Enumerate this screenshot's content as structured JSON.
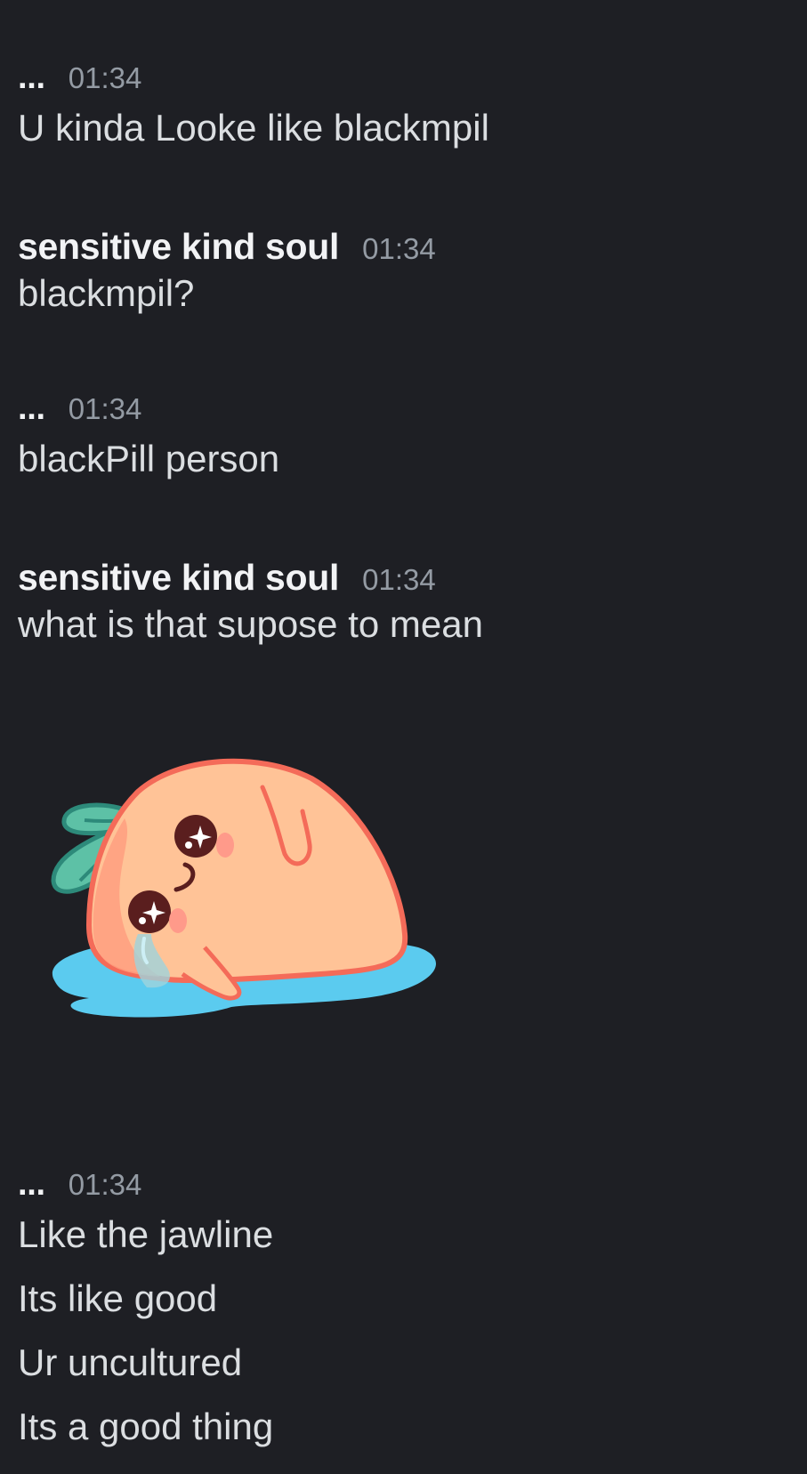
{
  "messages": [
    {
      "author": "...",
      "timestamp": "01:34",
      "lines": [
        "U kinda Looke like blackmpil"
      ]
    },
    {
      "author": "sensitive kind soul",
      "timestamp": "01:34",
      "lines": [
        "blackmpil?"
      ]
    },
    {
      "author": "...",
      "timestamp": "01:34",
      "lines": [
        "blackPill person"
      ]
    },
    {
      "author": "sensitive kind soul",
      "timestamp": "01:34",
      "lines": [
        "what is that supose to mean"
      ]
    },
    {
      "author": "...",
      "timestamp": "01:34",
      "lines": [
        "Like the jawline",
        "Its like good",
        "Ur uncultured",
        "Its a good thing"
      ]
    }
  ],
  "sticker": {
    "icon": "crying-peach-sticker",
    "colors": {
      "body": "#ffc397",
      "outline": "#f46b59",
      "leaf": "#5dc1a6",
      "puddle": "#5bcbef"
    }
  },
  "colors": {
    "background": "#1e1f24",
    "author": "#f2f3f5",
    "timestamp": "#949ba4",
    "text": "#dbdee1"
  }
}
